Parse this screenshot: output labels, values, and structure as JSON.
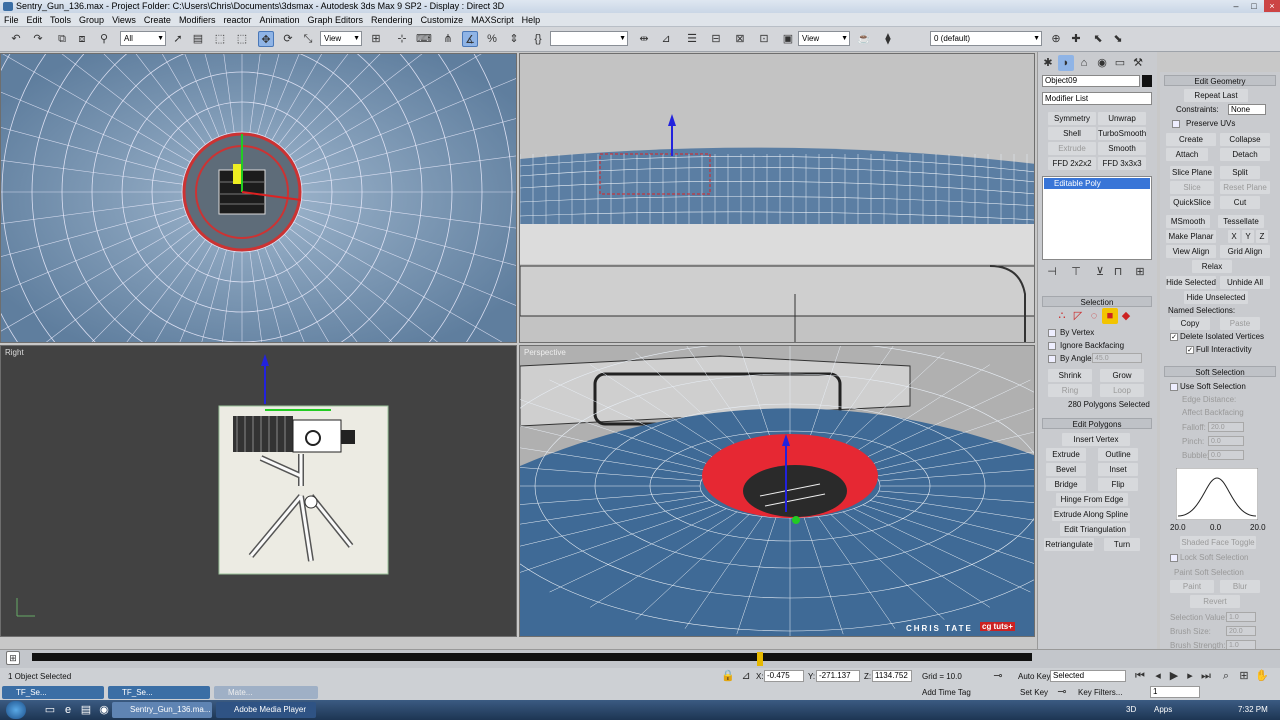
{
  "window": {
    "title": "Sentry_Gun_136.max    - Project Folder: C:\\Users\\Chris\\Documents\\3dsmax    - Autodesk 3ds Max 9 SP2    - Display : Direct 3D"
  },
  "menu": [
    "File",
    "Edit",
    "Tools",
    "Group",
    "Views",
    "Create",
    "Modifiers",
    "reactor",
    "Animation",
    "Graph Editors",
    "Rendering",
    "Customize",
    "MAXScript",
    "Help"
  ],
  "toolbar": {
    "selection_filter": "All",
    "ref_coord": "View",
    "ref_coord2": "View",
    "named_sel": "",
    "layer": "0 (default)",
    "snap_angle_label": "3D"
  },
  "viewports": {
    "top_left_label": "",
    "top_right_label": "",
    "bottom_left_label": "Right",
    "bottom_right_label": "Perspective",
    "watermark": "CHRIS TATE",
    "watermark_brand": "cg tuts+"
  },
  "command_panel": {
    "object_name": "Object09",
    "modifier_list": "Modifier List",
    "modifier_buttons": [
      "Symmetry",
      "Unwrap UVW",
      "Shell",
      "TurboSmooth",
      "Extrude",
      "Smooth",
      "FFD 2x2x2",
      "FFD 3x3x3"
    ],
    "stack_item": "Editable Poly",
    "selection_header": "Selection",
    "by_vertex": "By Vertex",
    "ignore_backfacing": "Ignore Backfacing",
    "by_angle": "By Angle:",
    "by_angle_value": "45.0",
    "shrink": "Shrink",
    "grow": "Grow",
    "ring": "Ring",
    "loop": "Loop",
    "selected_count": "280 Polygons Selected",
    "edit_polygons_header": "Edit Polygons",
    "insert_vertex": "Insert Vertex",
    "extrude": "Extrude",
    "outline": "Outline",
    "bevel": "Bevel",
    "inset": "Inset",
    "bridge": "Bridge",
    "flip": "Flip",
    "hinge_from_edge": "Hinge From Edge",
    "extrude_along_spline": "Extrude Along Spline",
    "edit_triangulation": "Edit Triangulation",
    "retriangulate": "Retriangulate",
    "turn": "Turn"
  },
  "rollout": {
    "edit_geometry_header": "Edit Geometry",
    "repeat_last": "Repeat Last",
    "constraints_label": "Constraints:",
    "constraints_value": "None",
    "preserve_uvs": "Preserve UVs",
    "create": "Create",
    "collapse": "Collapse",
    "attach": "Attach",
    "detach": "Detach",
    "slice_plane": "Slice Plane",
    "split": "Split",
    "slice": "Slice",
    "reset_plane": "Reset Plane",
    "quickslice": "QuickSlice",
    "cut": "Cut",
    "msmooth": "MSmooth",
    "tessellate": "Tessellate",
    "make_planar": "Make Planar",
    "x": "X",
    "y": "Y",
    "z": "Z",
    "view_align": "View Align",
    "grid_align": "Grid Align",
    "relax": "Relax",
    "hide_selected": "Hide Selected",
    "unhide_all": "Unhide All",
    "hide_unselected": "Hide Unselected",
    "named_selections": "Named Selections:",
    "copy": "Copy",
    "paste": "Paste",
    "delete_isolated": "Delete Isolated Vertices",
    "full_interactivity": "Full Interactivity",
    "soft_selection_header": "Soft Selection",
    "use_soft_selection": "Use Soft Selection",
    "edge_distance": "Edge Distance:",
    "affect_backfacing": "Affect Backfacing",
    "falloff": "Falloff:",
    "pinch": "Pinch:",
    "bubble": "Bubble:",
    "falloff_val": "20.0",
    "pinch_val": "0.0",
    "bubble_val": "0.0",
    "curve_left": "20.0",
    "curve_mid": "0.0",
    "curve_right": "20.0",
    "shaded_face_toggle": "Shaded Face Toggle",
    "lock_soft_selection": "Lock Soft Selection",
    "paint_soft_selection": "Paint Soft Selection",
    "paint": "Paint",
    "blur": "Blur",
    "revert": "Revert",
    "selection_value": "Selection Value:",
    "brush_size": "Brush Size:",
    "brush_strength": "Brush Strength:",
    "sel_val": "1.0",
    "brush_size_val": "20.0",
    "brush_strength_val": "1.0"
  },
  "timeline": {
    "frame": "0 / 100"
  },
  "status": {
    "objects_selected": "1 Object Selected",
    "x_label": "X:",
    "x": "-0.475",
    "y_label": "Y:",
    "y": "-271.137",
    "z_label": "Z:",
    "z": "1134.752",
    "grid": "Grid = 10.0",
    "add_time_tag": "Add Time Tag",
    "auto_key": "Auto Key",
    "auto_key_mode": "Selected",
    "set_key": "Set Key",
    "key_filters": "Key Filters...",
    "frame_spinner": "1"
  },
  "mini_tabs": [
    "TF_Se...",
    "TF_Se...",
    "Mate..."
  ],
  "taskbar": {
    "items": [
      "Sentry_Gun_136.ma...",
      "Adobe Media Player"
    ],
    "tray_3d": "3D",
    "tray_apps": "Apps",
    "clock": "7:32 PM"
  }
}
